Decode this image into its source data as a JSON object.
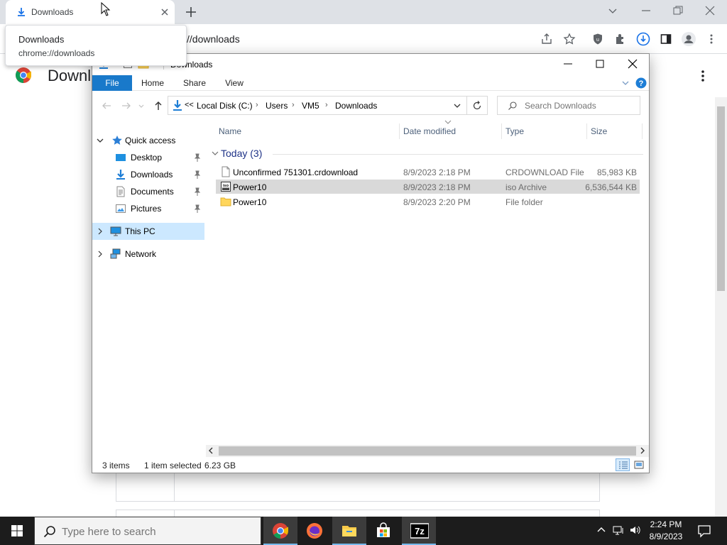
{
  "chrome": {
    "tab_title": "Downloads",
    "address": "//downloads",
    "tooltip_title": "Downloads",
    "tooltip_url": "chrome://downloads",
    "page_heading": "Downloads"
  },
  "explorer": {
    "window_title": "Downloads",
    "ribbon_tabs": [
      "File",
      "Home",
      "Share",
      "View"
    ],
    "breadcrumb": [
      "Local Disk (C:)",
      "Users",
      "VM5",
      "Downloads"
    ],
    "breadcrumb_overflow": "<<",
    "search_placeholder": "Search Downloads",
    "nav": {
      "quick_access": "Quick access",
      "items": [
        "Desktop",
        "Downloads",
        "Documents",
        "Pictures"
      ],
      "this_pc": "This PC",
      "network": "Network"
    },
    "columns": [
      "Name",
      "Date modified",
      "Type",
      "Size"
    ],
    "group_label": "Today (3)",
    "files": [
      {
        "name": "Unconfirmed 751301.crdownload",
        "date": "8/9/2023 2:18 PM",
        "type": "CRDOWNLOAD File",
        "size": "85,983 KB",
        "icon": "file-icon",
        "selected": false
      },
      {
        "name": "Power10",
        "date": "8/9/2023 2:18 PM",
        "type": "iso Archive",
        "size": "6,536,544 KB",
        "icon": "iso-archive-icon",
        "selected": true
      },
      {
        "name": "Power10",
        "date": "8/9/2023 2:20 PM",
        "type": "File folder",
        "size": "",
        "icon": "folder-icon",
        "selected": false
      }
    ],
    "status": {
      "items": "3 items",
      "selected": "1 item selected",
      "size": "6.23 GB"
    }
  },
  "taskbar": {
    "search_placeholder": "Type here to search",
    "apps": [
      "chrome-icon",
      "firefox-icon",
      "file-explorer-icon",
      "store-icon",
      "7zip-icon"
    ],
    "time": "2:24 PM",
    "date": "8/9/2023"
  },
  "colors": {
    "ribbon_file": "#1979ca",
    "nav_selected": "#cce8ff",
    "row_selected": "#d9d9d9",
    "taskbar": "#1c1c1c",
    "accent_blue": "#1a73e8"
  }
}
